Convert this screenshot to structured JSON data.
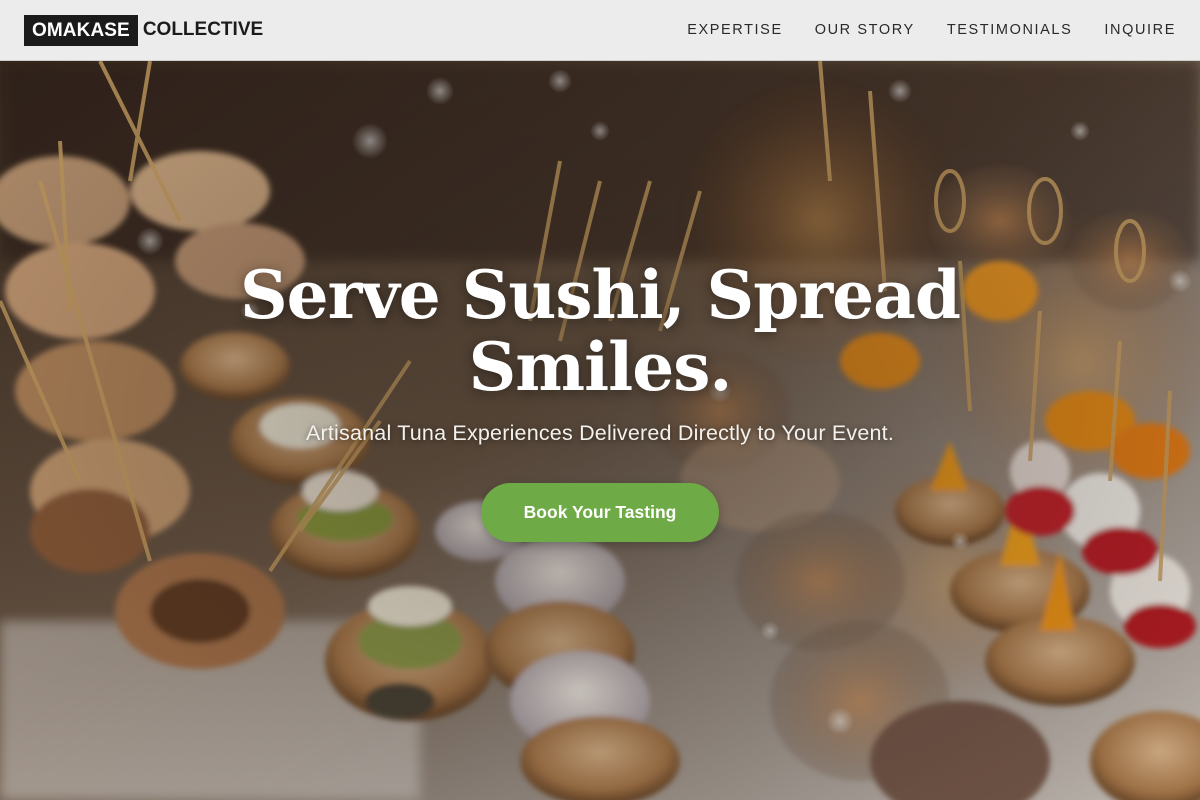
{
  "brand": {
    "boxed": "OMAKASE",
    "rest": "COLLECTIVE"
  },
  "nav": {
    "items": [
      {
        "label": "EXPERTISE"
      },
      {
        "label": "OUR STORY"
      },
      {
        "label": "TESTIMONIALS"
      },
      {
        "label": "INQUIRE"
      }
    ]
  },
  "hero": {
    "title_line1": "Serve Sushi, Spread",
    "title_line2": "Smiles.",
    "subtitle": "Artisanal Tuna Experiences Delivered Directly to Your Event.",
    "cta_label": "Book Your Tasting",
    "cta_color": "#6eaa45"
  }
}
